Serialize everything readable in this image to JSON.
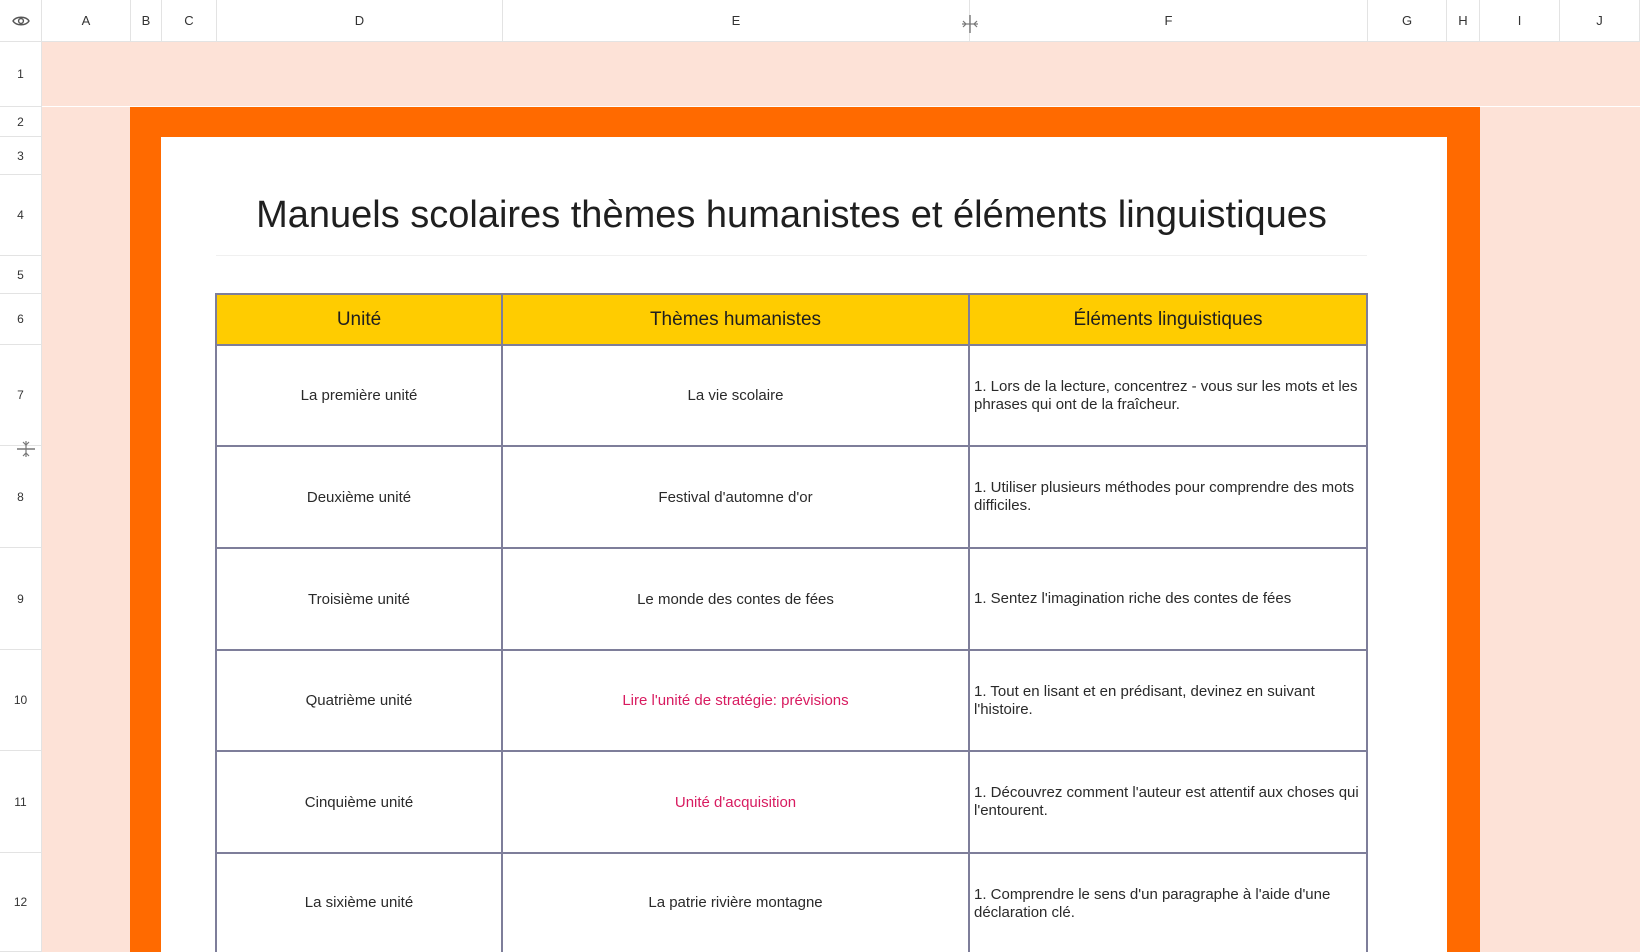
{
  "column_headers": [
    "A",
    "B",
    "C",
    "D",
    "E",
    "F",
    "G",
    "H",
    "I",
    "J"
  ],
  "row_headers": [
    "1",
    "2",
    "3",
    "4",
    "5",
    "6",
    "7",
    "8",
    "9",
    "10",
    "11",
    "12"
  ],
  "title": "Manuels scolaires thèmes humanistes et éléments linguistiques",
  "table": {
    "headers": [
      "Unité",
      "Thèmes humanistes",
      "Éléments linguistiques"
    ],
    "rows": [
      {
        "unit": "La première unité",
        "theme": "La vie scolaire",
        "element": "1. Lors de la lecture, concentrez - vous sur les mots et les phrases qui ont de la fraîcheur."
      },
      {
        "unit": "Deuxième unité",
        "theme": "Festival d'automne d'or",
        "element": "1. Utiliser plusieurs méthodes pour comprendre des mots difficiles."
      },
      {
        "unit": "Troisième unité",
        "theme": "Le monde des contes de fées",
        "element": "1. Sentez l'imagination riche des contes de fées"
      },
      {
        "unit": "Quatrième unité",
        "theme": "Lire l'unité de stratégie: prévisions",
        "element": "1. Tout en lisant et en prédisant, devinez en suivant l'histoire."
      },
      {
        "unit": "Cinquième unité",
        "theme": "Unité d'acquisition",
        "element": "1. Découvrez comment l'auteur est attentif aux choses qui l'entourent."
      },
      {
        "unit": "La sixième unité",
        "theme": "La patrie rivière montagne",
        "element": "1. Comprendre le sens d'un paragraphe à l'aide d'une déclaration clé."
      }
    ]
  },
  "colors": {
    "background": "#fde2d7",
    "frame": "#ff6a00",
    "header_fill": "#ffcc00",
    "highlight_text": "#d81b60",
    "grid_line": "#7e7e9a"
  },
  "icons": {
    "corner": "eye-icon",
    "column_resize": "column-resize-icon",
    "row_resize": "row-resize-icon"
  }
}
